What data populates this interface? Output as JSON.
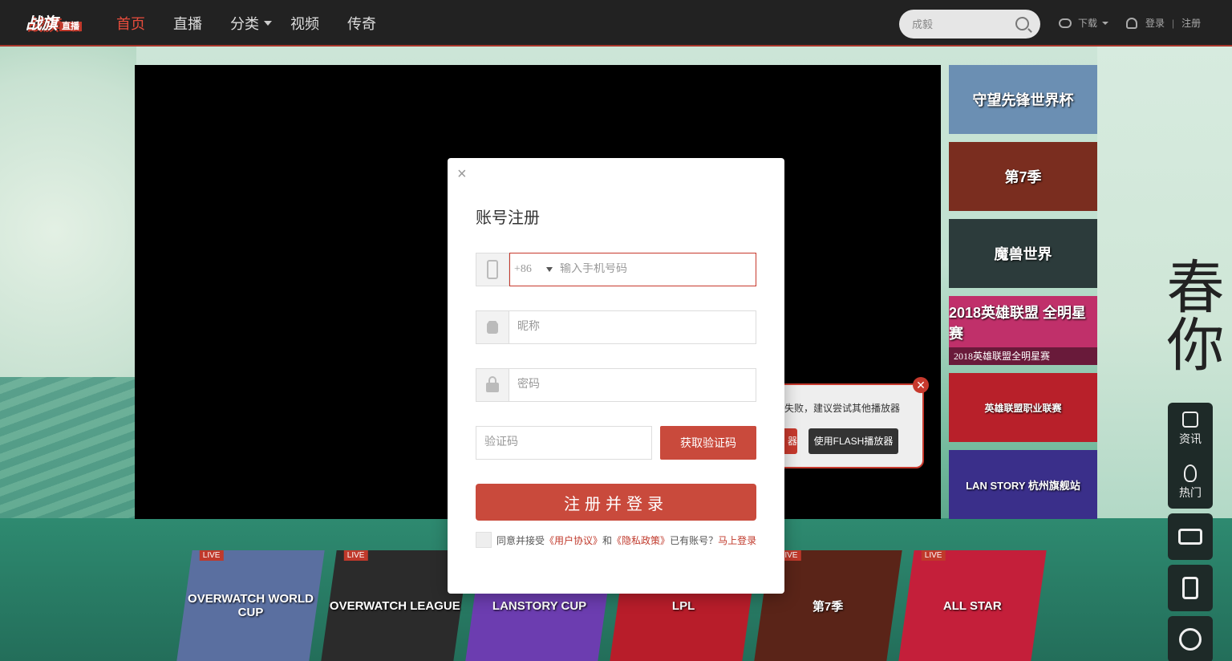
{
  "header": {
    "logo_text": "战旗",
    "logo_sub": "直播",
    "nav": [
      {
        "label": "首页",
        "active": true
      },
      {
        "label": "直播"
      },
      {
        "label": "分类"
      },
      {
        "label": "视频"
      },
      {
        "label": "传奇"
      }
    ],
    "search_placeholder": "成毅",
    "download_label": "下载",
    "login_label": "登录",
    "register_label": "注册",
    "separator": "|"
  },
  "player": {
    "flash_message": "失败，建议尝试其他播放器",
    "flash_btn_partial": "器",
    "flash_btn": "使用FLASH播放器",
    "close_symbol": "✕"
  },
  "channels": [
    {
      "title": "守望先锋世界杯",
      "bg": "#6b8fb3"
    },
    {
      "title": "第7季",
      "bg": "#7a2d1f"
    },
    {
      "title": "魔兽世界",
      "bg": "#2c3b3b"
    },
    {
      "title": "2018英雄联盟 全明星赛",
      "caption": "2018英雄联盟全明星赛",
      "bg": "#c0306a"
    },
    {
      "title": "英雄联盟职业联赛",
      "bg": "#b8202a"
    },
    {
      "title": "LAN STORY 杭州旗舰站",
      "bg": "#3a2f8a"
    }
  ],
  "float_tools": {
    "news_label": "资讯",
    "hot_label": "热门"
  },
  "cards": [
    {
      "title": "OVERWATCH WORLD CUP",
      "live": "LIVE",
      "bg": "#5a6fa0"
    },
    {
      "title": "OVERWATCH LEAGUE",
      "live": "LIVE",
      "bg": "#2b2b2b"
    },
    {
      "title": "LANSTORY CUP",
      "live": "",
      "bg": "#6c3db0"
    },
    {
      "title": "LPL",
      "live": "",
      "bg": "#b81d2a"
    },
    {
      "title": "第7季",
      "live": "LIVE",
      "bg": "#5a2418"
    },
    {
      "title": "ALL STAR",
      "live": "LIVE",
      "bg": "#c41f3a"
    }
  ],
  "modal": {
    "close_symbol": "×",
    "title": "账号注册",
    "country_code": "+86",
    "phone_placeholder": "输入手机号码",
    "nickname_placeholder": "昵称",
    "password_placeholder": "密码",
    "code_placeholder": "验证码",
    "get_code_label": "获取验证码",
    "submit_label": "注册并登录",
    "agree_prefix": "同意并接受",
    "user_agreement": "《用户协议》",
    "and_text": "和",
    "privacy_policy": "《隐私政策》",
    "have_account": "已有账号？",
    "login_now": "马上登录"
  },
  "spring_text": "春你",
  "colors": {
    "accent": "#c94a3c",
    "nav_bg": "#222222"
  }
}
